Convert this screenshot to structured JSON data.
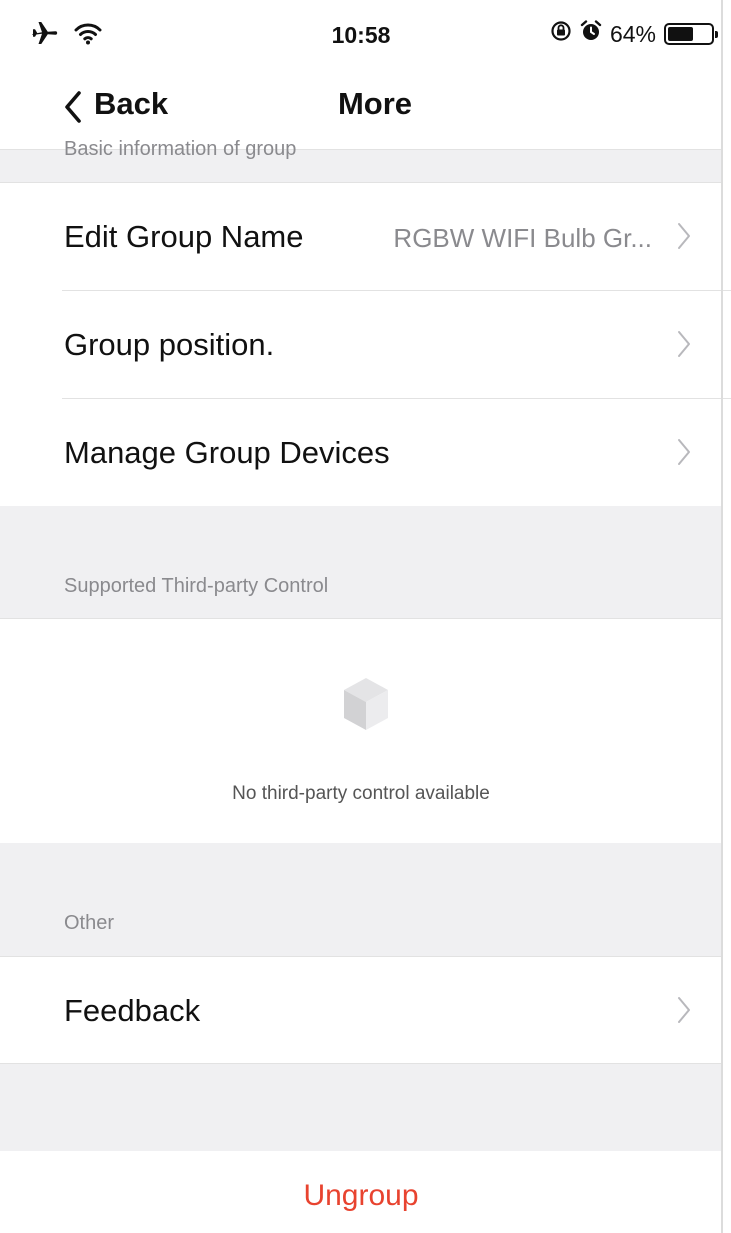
{
  "status_bar": {
    "time": "10:58",
    "battery_percent": "64%",
    "battery_level": 0.64,
    "icons": [
      "airplane-icon",
      "wifi-icon",
      "orientation-lock-icon",
      "alarm-icon",
      "battery-icon"
    ]
  },
  "nav": {
    "back_label": "Back",
    "title": "More"
  },
  "sections": {
    "basic_info_header": "Basic information of group",
    "third_party_header": "Supported Third-party Control",
    "other_header": "Other"
  },
  "rows": {
    "edit_group_name": {
      "label": "Edit Group Name",
      "value": "RGBW WIFI Bulb Gr..."
    },
    "group_position": {
      "label": "Group position."
    },
    "manage_devices": {
      "label": "Manage Group Devices"
    },
    "feedback": {
      "label": "Feedback"
    }
  },
  "third_party": {
    "empty_message": "No third-party control available",
    "icon": "cube-icon"
  },
  "actions": {
    "ungroup_label": "Ungroup"
  },
  "colors": {
    "accent_red": "#e8432f",
    "section_background": "#f0f0f2",
    "secondary_text": "#8a8a8e"
  }
}
